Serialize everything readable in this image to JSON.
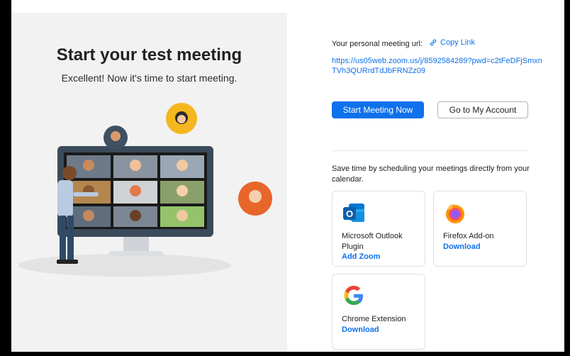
{
  "left": {
    "title": "Start your test meeting",
    "subtitle": "Excellent! Now it's time to start meeting."
  },
  "right": {
    "url_label": "Your personal meeting url:",
    "copy_link": "Copy Link",
    "meeting_url": "https://us05web.zoom.us/j/8592584289?pwd=c2tFeDFjSmxnTVh3QURrdTdJbFRNZz09",
    "start_button": "Start Meeting Now",
    "account_button": "Go to My Account",
    "schedule_text": "Save time by scheduling your meetings directly from your calendar.",
    "cards": [
      {
        "label": "Microsoft Outlook Plugin",
        "action": "Add Zoom",
        "icon": "outlook-icon"
      },
      {
        "label": "Firefox Add-on",
        "action": "Download",
        "icon": "firefox-icon"
      },
      {
        "label": "Chrome Extension",
        "action": "Download",
        "icon": "google-icon"
      }
    ]
  },
  "colors": {
    "accent": "#0e71eb",
    "left_background": "#f2f2f2"
  }
}
